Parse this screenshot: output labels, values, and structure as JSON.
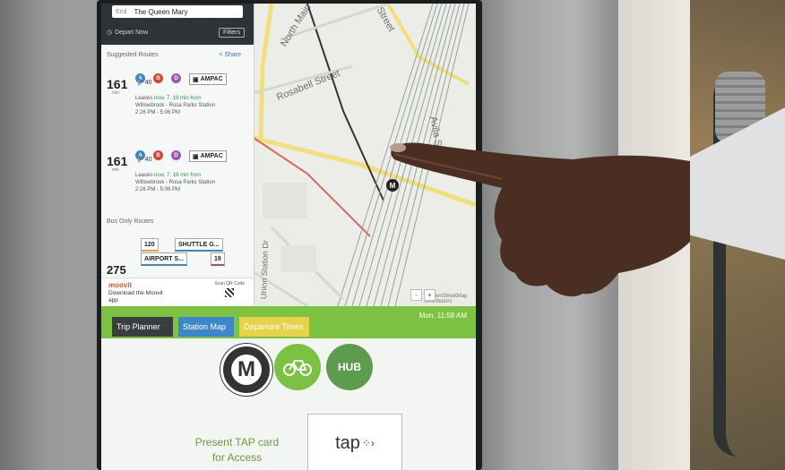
{
  "panel": {
    "end_key": "End",
    "end_value": "The Queen Mary",
    "depart_label": "Depart Now",
    "filters_label": "Filters",
    "suggested_label": "Suggested Routes",
    "share_label": "Share",
    "routes": [
      {
        "mins": "161",
        "mins_label": "min",
        "walk": "40",
        "line_a": "A",
        "line_b": "B",
        "line_c": "D",
        "bus": "AMPAC",
        "leaves_prefix": "Leaves",
        "leaves_when": "now, 7, 19 min from",
        "station": "Willowbrook - Rosa Parks Station",
        "times": "2:26 PM  -  5:06 PM"
      },
      {
        "mins": "161",
        "mins_label": "min",
        "walk": "40",
        "line_a": "A",
        "line_b": "B",
        "line_c": "D",
        "bus": "AMPAC",
        "leaves_prefix": "Leaves",
        "leaves_when": "now, 7, 19 min from",
        "station": "Willowbrook - Rosa Parks Station",
        "times": "2:26 PM  -  5:06 PM"
      }
    ],
    "bus_only_label": "Bus Only Routes",
    "bus_row1": [
      "120",
      "SHUTTLE G..."
    ],
    "bus_row2": [
      "AIRPORT S...",
      "19"
    ],
    "third_mins": "275",
    "moovit_logo": "moovit",
    "moovit_download": "Download the Moovit app",
    "scan_label": "Scan QR Code"
  },
  "map": {
    "streets": [
      "North Main St",
      "Street",
      "Rosabell Street",
      "Avila St",
      "Union Station Dr"
    ],
    "attribution": "© OpenStreetMap contributors",
    "metro_pin": "M",
    "zoom_out": "-",
    "zoom_in": "+"
  },
  "tabs": {
    "trip": "Trip Planner",
    "station": "Station Map",
    "departure": "Departure Times",
    "clock": "Mon, 11:58 AM"
  },
  "lower": {
    "metro_letter": "M",
    "hub_label": "HUB",
    "tap_text": "Present TAP card for Access",
    "tap_logo": "tap"
  },
  "icons": [
    "walk-icon",
    "bus-icon",
    "share-icon",
    "bike-icon",
    "clock-icon"
  ],
  "colors": {
    "tab_bar": "#7ec243",
    "trip_tab": "#3a3d40",
    "station_tab": "#3d86c8",
    "departure_tab": "#e7d24a",
    "line_a": "#3d86c8",
    "line_b": "#d8453c",
    "line_c": "#9a5ab4"
  }
}
